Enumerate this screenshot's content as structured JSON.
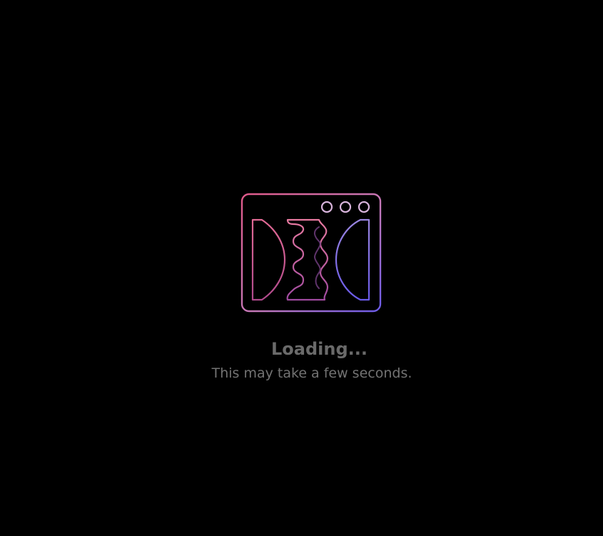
{
  "loading": {
    "logo_icon": "app-window-logo-icon",
    "title": "Loading...",
    "subtitle": "This may take a few seconds."
  },
  "colors": {
    "background": "#000000",
    "text": "#6a6a6a",
    "gradient_start": "#e05a8a",
    "gradient_mid": "#c478b8",
    "gradient_end": "#6b5be8",
    "dots": "#d8b4dc"
  }
}
